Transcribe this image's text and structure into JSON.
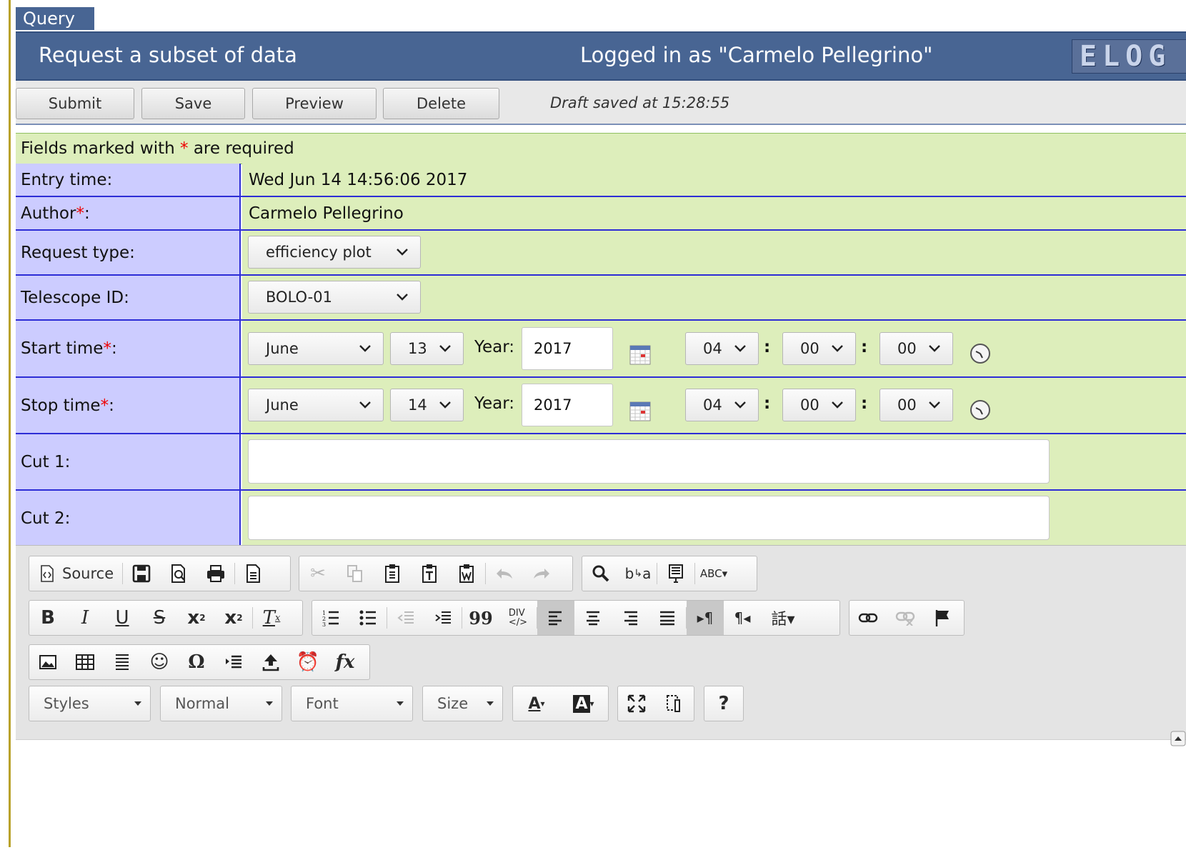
{
  "tab": {
    "label": "Query"
  },
  "header": {
    "title": "Request a subset of data",
    "logged_in": "Logged in as \"Carmelo Pellegrino\"",
    "logo": "ELOG"
  },
  "toolbar": {
    "submit": "Submit",
    "save": "Save",
    "preview": "Preview",
    "delete": "Delete",
    "draft_status": "Draft saved at 15:28:55"
  },
  "form": {
    "required_prefix": "Fields marked with ",
    "required_star": "*",
    "required_suffix": " are required",
    "entry_time": {
      "label": "Entry time:",
      "value": "Wed Jun 14 14:56:06 2017"
    },
    "author": {
      "label": "Author",
      "star": "*",
      "colon": ":",
      "value": "Carmelo Pellegrino"
    },
    "request_type": {
      "label": "Request type:",
      "value": "efficiency plot"
    },
    "telescope_id": {
      "label": "Telescope ID:",
      "value": "BOLO-01"
    },
    "start_time": {
      "label": "Start time",
      "star": "*",
      "colon": ":",
      "month": "June",
      "day": "13",
      "year_label": "Year:",
      "year": "2017",
      "hour": "04",
      "minute": "00",
      "second": "00"
    },
    "stop_time": {
      "label": "Stop time",
      "star": "*",
      "colon": ":",
      "month": "June",
      "day": "14",
      "year_label": "Year:",
      "year": "2017",
      "hour": "04",
      "minute": "00",
      "second": "00"
    },
    "cut1": {
      "label": "Cut 1:",
      "value": ""
    },
    "cut2": {
      "label": "Cut 2:",
      "value": ""
    },
    "time_separator": ":"
  },
  "editor": {
    "source_label": "Source",
    "styles": "Styles",
    "format": "Normal",
    "font": "Font",
    "size": "Size",
    "help": "?",
    "bold": "B",
    "italic": "I",
    "underline": "U",
    "strike": "S",
    "blockquote": "99",
    "special_char": "Ω",
    "formula": "fx"
  },
  "colors": {
    "header_bg": "#486593",
    "label_bg": "#ccccff",
    "value_bg": "#ddeebb",
    "required_star": "#ee0000"
  }
}
